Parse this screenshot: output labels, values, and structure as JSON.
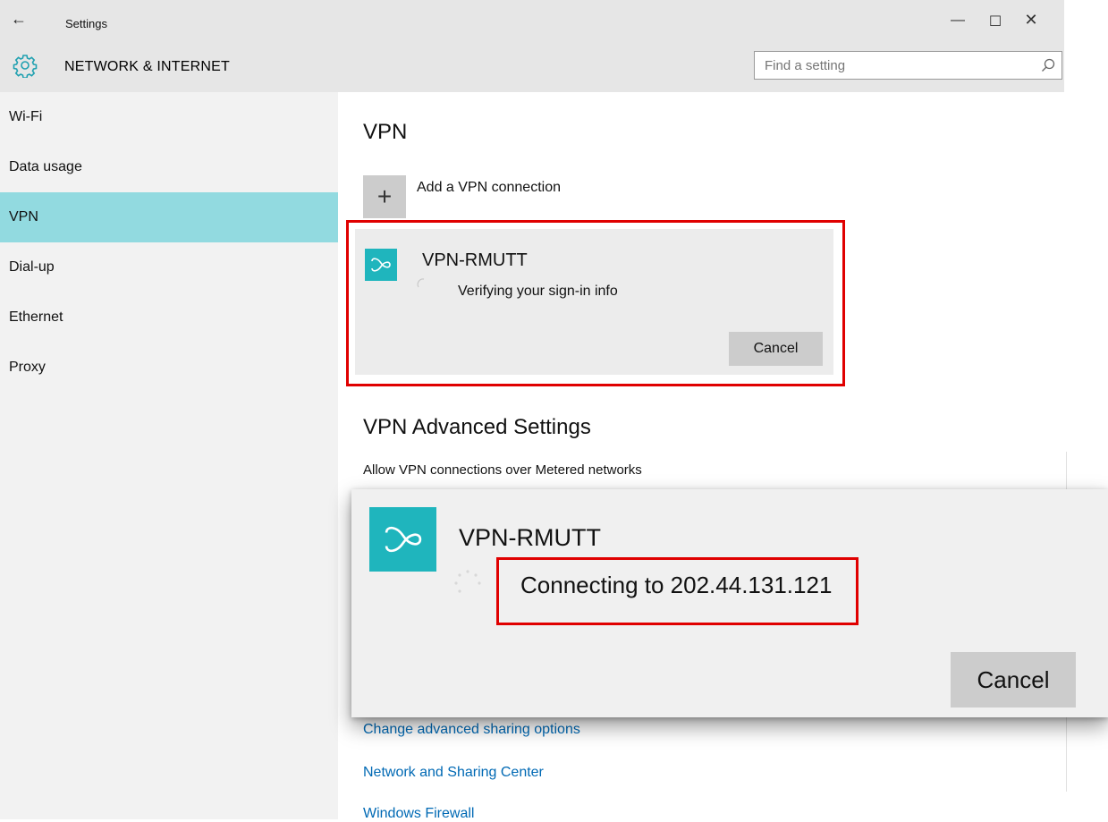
{
  "window": {
    "title": "Settings",
    "back_icon": "←",
    "minimize_icon": "—",
    "maximize_icon": "☐",
    "close_icon": "✕"
  },
  "header": {
    "section_title": "NETWORK & INTERNET",
    "search_placeholder": "Find a setting"
  },
  "sidebar": {
    "items": [
      {
        "label": "Wi-Fi"
      },
      {
        "label": "Data usage"
      },
      {
        "label": "VPN"
      },
      {
        "label": "Dial-up"
      },
      {
        "label": "Ethernet"
      },
      {
        "label": "Proxy"
      }
    ],
    "active_index": 2
  },
  "main": {
    "heading": "VPN",
    "add_symbol": "+",
    "add_label": "Add a VPN connection",
    "connection": {
      "name": "VPN-RMUTT",
      "status": "Verifying your sign-in info",
      "cancel_label": "Cancel"
    },
    "advanced_heading": "VPN Advanced Settings",
    "advanced_desc": "Allow VPN connections over Metered networks",
    "links": [
      {
        "label": "Change advanced sharing options"
      },
      {
        "label": "Network and Sharing Center"
      },
      {
        "label": "Windows Firewall"
      }
    ]
  },
  "popup": {
    "name": "VPN-RMUTT",
    "status": "Connecting to 202.44.131.121",
    "cancel_label": "Cancel"
  },
  "colors": {
    "accent": "#92dae0",
    "logo": "#1fb5bd",
    "highlight": "#e00000",
    "link": "#0069b4"
  }
}
